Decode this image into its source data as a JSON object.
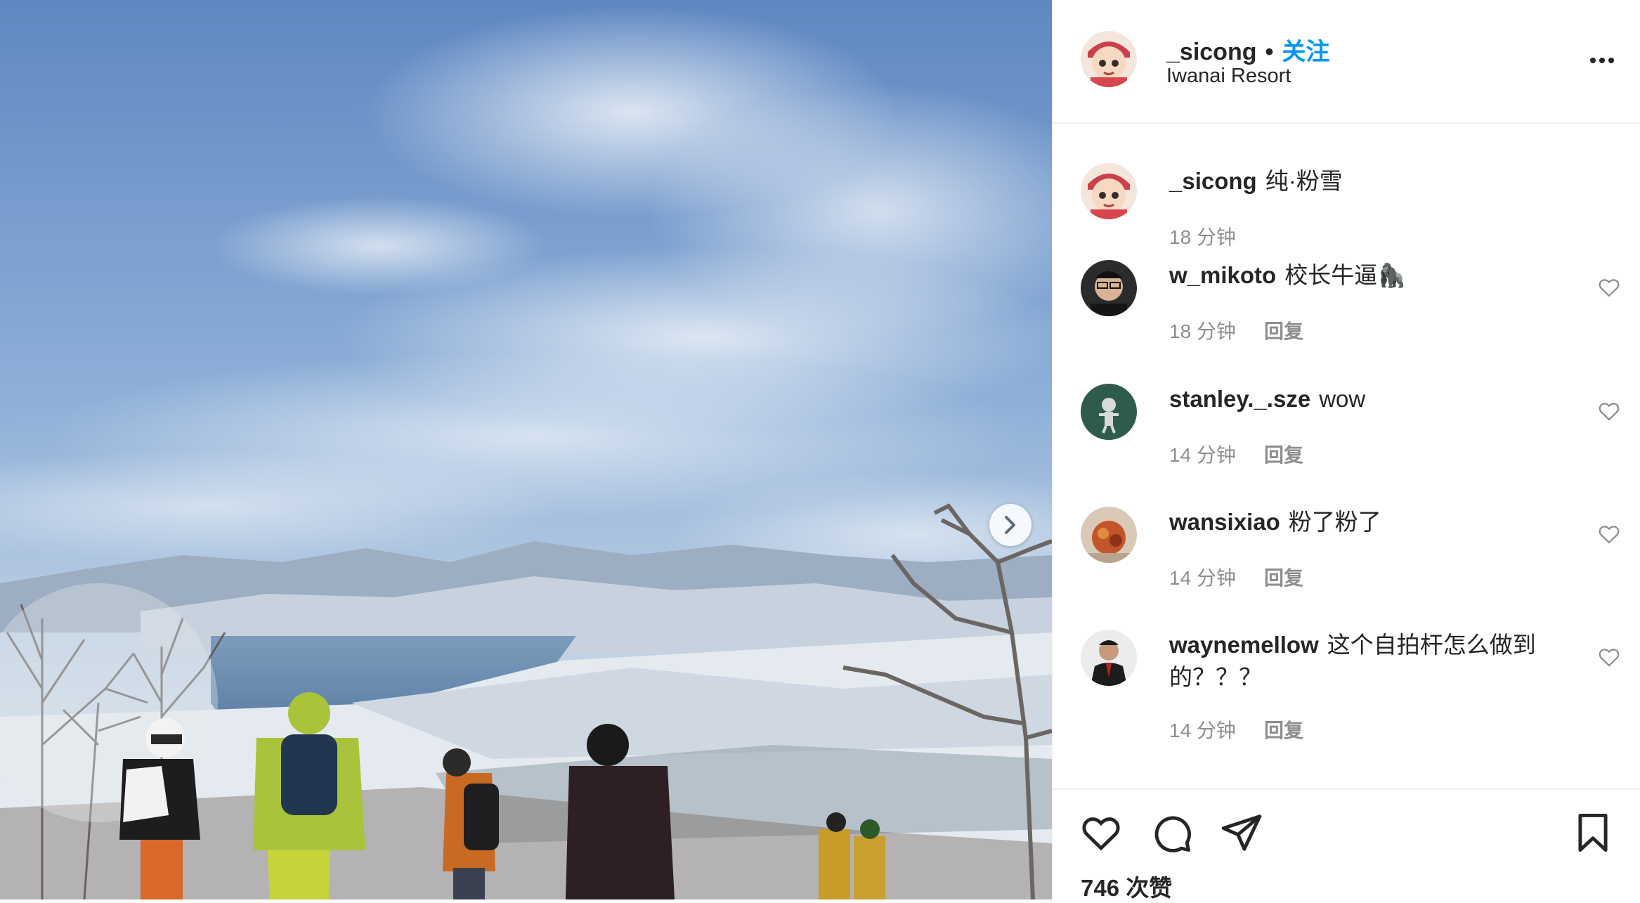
{
  "post": {
    "username": "_sicong",
    "separator": "•",
    "follow_label": "关注",
    "location": "Iwanai Resort",
    "caption": "纯·粉雪",
    "caption_time": "18 分钟",
    "likes": "746 次赞"
  },
  "comments": [
    {
      "user": "w_mikoto",
      "text": "校长牛逼🦍",
      "time": "18 分钟",
      "reply": "回复"
    },
    {
      "user": "stanley._.sze",
      "text": "wow",
      "time": "14 分钟",
      "reply": "回复"
    },
    {
      "user": "wansixiao",
      "text": "粉了粉了",
      "time": "14 分钟",
      "reply": "回复"
    },
    {
      "user": "waynemellow",
      "text": "这个自拍杆怎么做到的？？？",
      "time": "14 分钟",
      "reply": "回复"
    }
  ],
  "icons": {
    "more": "more-options-icon",
    "next": "chevron-right-icon",
    "like": "heart-icon",
    "comment": "comment-bubble-icon",
    "share": "paper-plane-icon",
    "save": "bookmark-icon"
  },
  "colors": {
    "follow": "#0095f6",
    "text": "#262626",
    "muted": "#8e8e8e",
    "divider": "#efefef"
  }
}
